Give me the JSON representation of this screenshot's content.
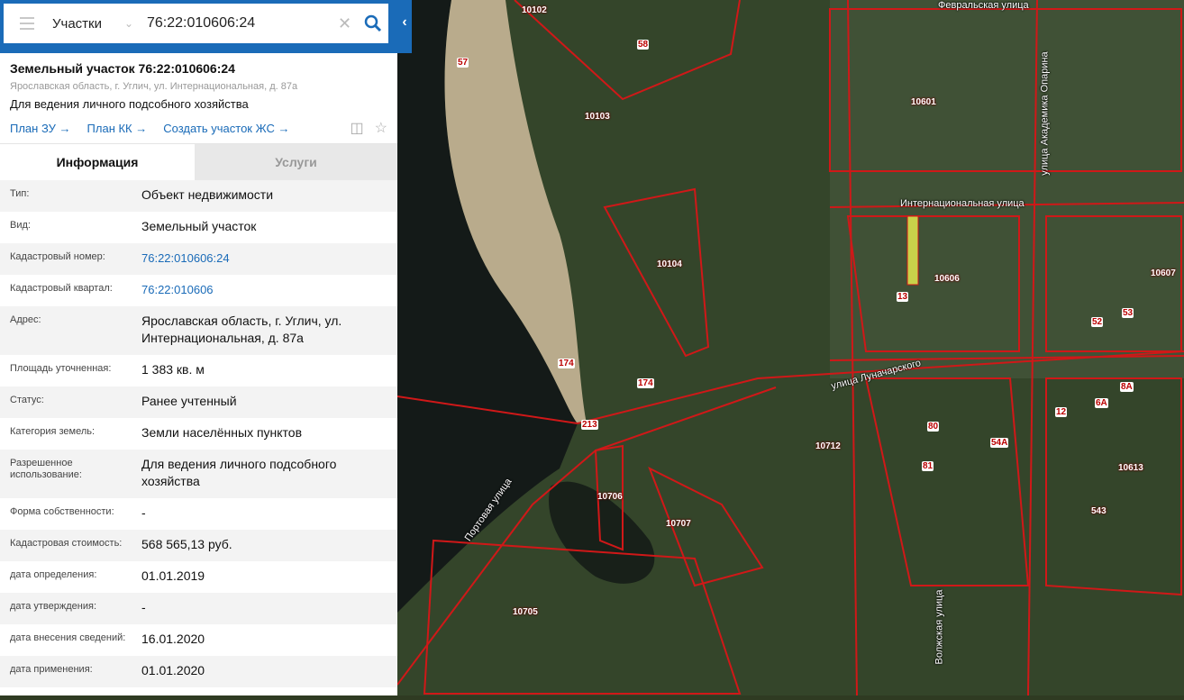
{
  "search": {
    "category": "Участки",
    "value": "76:22:010606:24"
  },
  "object": {
    "title": "Земельный участок 76:22:010606:24",
    "address": "Ярославская область, г. Углич, ул. Интернациональная, д. 87а",
    "purpose": "Для ведения личного подсобного хозяйства"
  },
  "links": [
    "План ЗУ →",
    "План КК →",
    "Создать участок ЖС →"
  ],
  "tabs": [
    "Информация",
    "Услуги"
  ],
  "rows": [
    {
      "label": "Тип:",
      "value": "Объект недвижимости"
    },
    {
      "label": "Вид:",
      "value": "Земельный участок"
    },
    {
      "label": "Кадастровый номер:",
      "value": "76:22:010606:24"
    },
    {
      "label": "Кадастровый квартал:",
      "value": "76:22:010606"
    },
    {
      "label": "Адрес:",
      "value": "Ярославская область, г. Углич, ул. Интернациональная, д. 87а"
    },
    {
      "label": "Площадь уточненная:",
      "value": "1 383 кв. м"
    },
    {
      "label": "Статус:",
      "value": "Ранее учтенный"
    },
    {
      "label": "Категория земель:",
      "value": "Земли населённых пунктов"
    },
    {
      "label": "Разрешенное использование:",
      "value": "Для ведения личного подсобного хозяйства"
    },
    {
      "label": "Форма собственности:",
      "value": "-"
    },
    {
      "label": "Кадастровая стоимость:",
      "value": "568 565,13 руб."
    },
    {
      "label": "дата определения:",
      "value": "01.01.2019"
    },
    {
      "label": "дата утверждения:",
      "value": "-"
    },
    {
      "label": "дата внесения сведений:",
      "value": "16.01.2020"
    },
    {
      "label": "дата применения:",
      "value": "01.01.2020"
    }
  ],
  "map": {
    "streets": [
      "Интернациональная улица",
      "улица Луначарского",
      "Портовая улица",
      "Волжская улица",
      "улица Академика Опарина",
      "Февральская улица"
    ],
    "blocks": [
      "10102",
      "10103",
      "10104",
      "10601",
      "10606",
      "10607",
      "10712",
      "10613",
      "10706",
      "10707",
      "10705",
      "543"
    ],
    "numbers": [
      "57",
      "58",
      "174",
      "174",
      "213",
      "81",
      "80",
      "54А",
      "6А",
      "8А",
      "13",
      "52",
      "53",
      "12"
    ]
  }
}
